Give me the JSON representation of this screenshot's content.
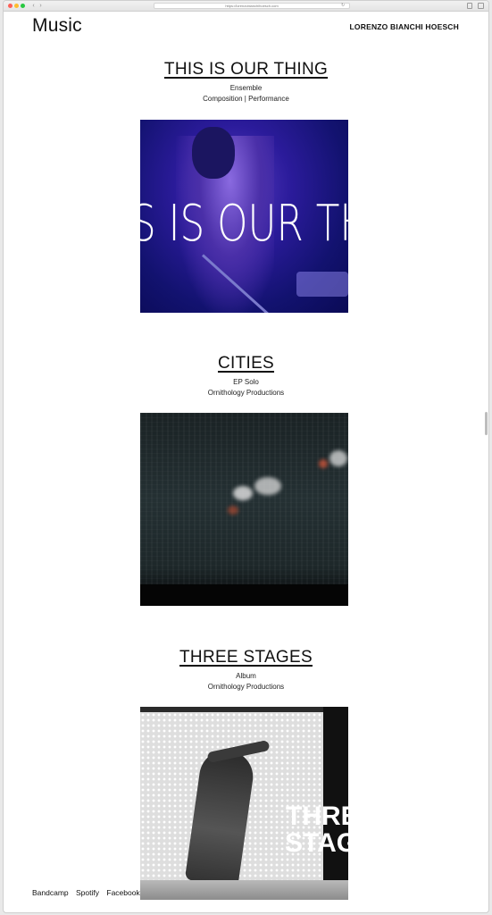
{
  "browser": {
    "url": "https://lorenzobianchihoesch.com"
  },
  "header": {
    "title": "Music",
    "author": "LORENZO BIANCHI HOESCH"
  },
  "projects": [
    {
      "title": "THIS IS OUR THING",
      "line1": "Ensemble",
      "line2": "Composition | Performance",
      "cover_text": "S IS OUR TH"
    },
    {
      "title": "CITIES",
      "line1": "EP Solo",
      "line2": "Ornithology Productions"
    },
    {
      "title": "THREE STAGES",
      "line1": "Album",
      "line2": "Ornithology Productions",
      "cover_text_1": "THRE",
      "cover_text_2": "STAG"
    }
  ],
  "footer": {
    "links": [
      "Bandcamp",
      "Spotify",
      "Facebook"
    ]
  }
}
